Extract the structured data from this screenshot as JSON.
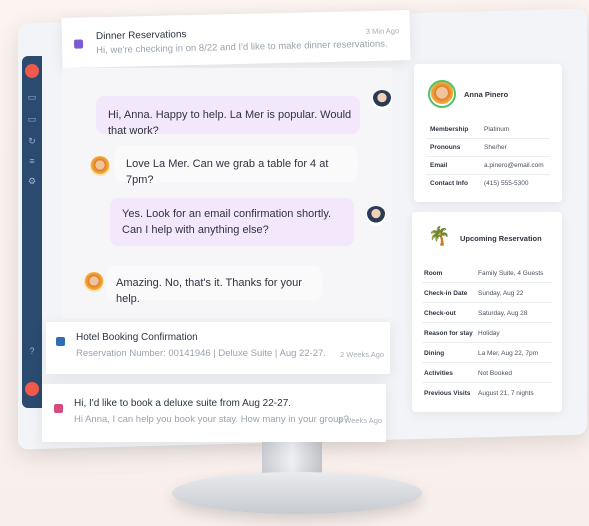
{
  "inbox": [
    {
      "subject": "Dinner Reservations",
      "preview": "Hi, we're checking in on 8/22 and I'd like to make dinner reservations.",
      "time": "3 Min Ago"
    },
    {
      "subject": "Hotel Booking Confirmation",
      "preview": "Reservation Number: 00141946 | Deluxe Suite | Aug 22-27.",
      "time": "2 Weeks Ago"
    },
    {
      "subject": "Hi, I'd like to book a deluxe suite from Aug 22-27.",
      "preview": "Hi Anna, I can help you book your stay. How many in your group?",
      "time": "3 Weeks Ago"
    }
  ],
  "chat": [
    {
      "from": "agent",
      "text": "Hi, Anna. Happy to help. La Mer is popular. Would that work?"
    },
    {
      "from": "customer",
      "text": "Love La Mer. Can we grab a table for 4 at 7pm?"
    },
    {
      "from": "agent",
      "text": "Yes. Look for an email confirmation shortly. Can I help with anything else?"
    },
    {
      "from": "customer",
      "text": "Amazing. No, that's it. Thanks for your help."
    }
  ],
  "profile": {
    "name": "Anna Pinero",
    "rows": [
      {
        "k": "Membership",
        "v": "Platinum"
      },
      {
        "k": "Pronouns",
        "v": "She/her"
      },
      {
        "k": "Email",
        "v": "a.pinero@email.com"
      },
      {
        "k": "Contact Info",
        "v": "(415) 555-5300"
      }
    ]
  },
  "reservation": {
    "title": "Upcoming Reservation",
    "rows": [
      {
        "k": "Room",
        "v": "Family Suite, 4 Guests"
      },
      {
        "k": "Check-in Date",
        "v": "Sunday, Aug 22"
      },
      {
        "k": "Check-out",
        "v": "Saturday, Aug 28"
      },
      {
        "k": "Reason for stay",
        "v": "Holiday"
      },
      {
        "k": "Dining",
        "v": "La Mer, Aug 22, 7pm"
      },
      {
        "k": "Activities",
        "v": "Not Booked"
      },
      {
        "k": "Previous Visits",
        "v": "August 21, 7 nights"
      }
    ]
  },
  "colors": {
    "sidebar": "#2a4a6f",
    "agent_bubble": "#f3e8fb",
    "online": "#4cc36a"
  }
}
